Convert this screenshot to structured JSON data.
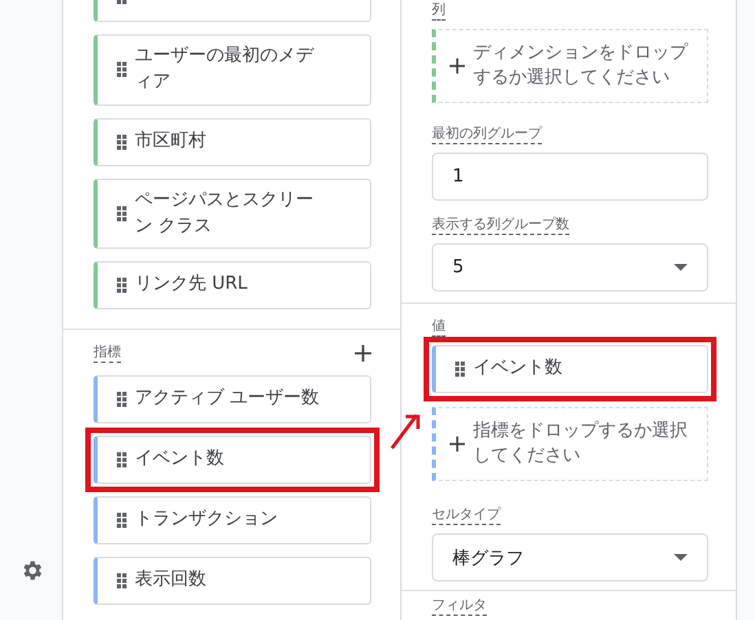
{
  "dimensions": {
    "items": [
      {
        "label": "ユーザーの最初のメディア",
        "highlighted": false
      },
      {
        "label": "市区町村",
        "highlighted": false
      },
      {
        "label": "ページパスとスクリーン クラス",
        "highlighted": false
      },
      {
        "label": "リンク先 URL",
        "highlighted": false
      }
    ]
  },
  "metrics": {
    "label": "指標",
    "items": [
      {
        "label": "アクティブ ユーザー数",
        "highlighted": false
      },
      {
        "label": "イベント数",
        "highlighted": true
      },
      {
        "label": "トランザクション",
        "highlighted": false
      },
      {
        "label": "表示回数",
        "highlighted": false
      }
    ]
  },
  "panel": {
    "columns": {
      "label": "列",
      "drop_hint": "ディメンションをドロップするか選択してください"
    },
    "first_column_group": {
      "label": "最初の列グループ",
      "value": "1"
    },
    "column_group_count": {
      "label": "表示する列グループ数",
      "value": "5"
    },
    "values": {
      "label": "値",
      "items": [
        {
          "label": "イベント数",
          "highlighted": true
        }
      ],
      "drop_hint": "指標をドロップするか選択してください"
    },
    "cell_type": {
      "label": "セルタイプ",
      "value": "棒グラフ"
    },
    "filter": {
      "label": "フィルタ"
    }
  }
}
